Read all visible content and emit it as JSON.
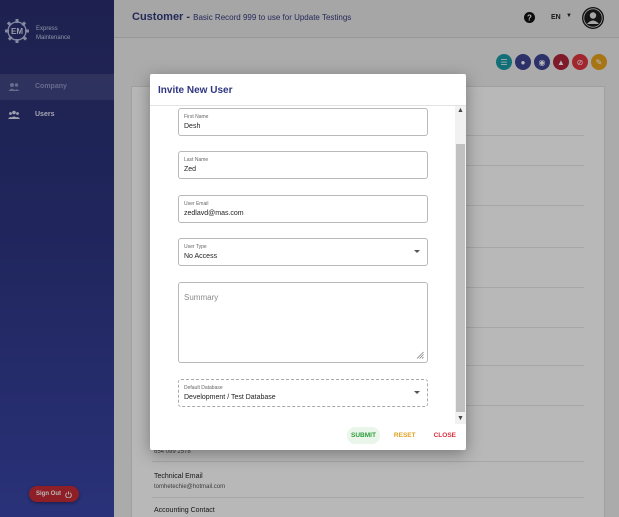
{
  "brand": {
    "line1": "Express",
    "line2": "Maintenance"
  },
  "sidebar": {
    "items": [
      {
        "label": "Company"
      },
      {
        "label": "Users"
      }
    ],
    "signout_label": "Sign Out"
  },
  "header": {
    "title": "Customer",
    "subtitle": "Basic Record 999 to use for Update Testings",
    "language": "EN"
  },
  "colors": {
    "sidebar_top": "#2a2f6e",
    "sidebar_bottom": "#3a45a8",
    "accent": "#2f3680",
    "submit": "#2e9c3c",
    "reset": "#e0a020",
    "close": "#d6303a"
  },
  "actions": [
    {
      "icon": "database-icon",
      "color": "#1a9aa6"
    },
    {
      "icon": "group-icon",
      "color": "#3d4593"
    },
    {
      "icon": "people-icon",
      "color": "#3d4593"
    },
    {
      "icon": "sitemap-icon",
      "color": "#b0243c"
    },
    {
      "icon": "block-icon",
      "color": "#e0353f"
    },
    {
      "icon": "edit-icon",
      "color": "#e8a21c"
    }
  ],
  "background_card": {
    "phone_value": "654 099 2578",
    "technical_email_label": "Technical Email",
    "technical_email_value": "tomhetechie@hotmail.com",
    "accounting_contact_label": "Accounting Contact"
  },
  "dialog": {
    "title": "Invite New User",
    "fields": {
      "first_name": {
        "label": "First Name",
        "value": "Desh"
      },
      "last_name": {
        "label": "Last Name",
        "value": "Zed"
      },
      "email": {
        "label": "User Email",
        "value": "zedlavd@mas.com"
      },
      "user_type": {
        "label": "User Type",
        "value": "No Access"
      },
      "summary": {
        "placeholder": "Summary"
      },
      "default_database": {
        "label": "Default Database",
        "value": "Development / Test Database"
      }
    },
    "buttons": {
      "submit": "SUBMIT",
      "reset": "RESET",
      "close": "CLOSE"
    }
  }
}
